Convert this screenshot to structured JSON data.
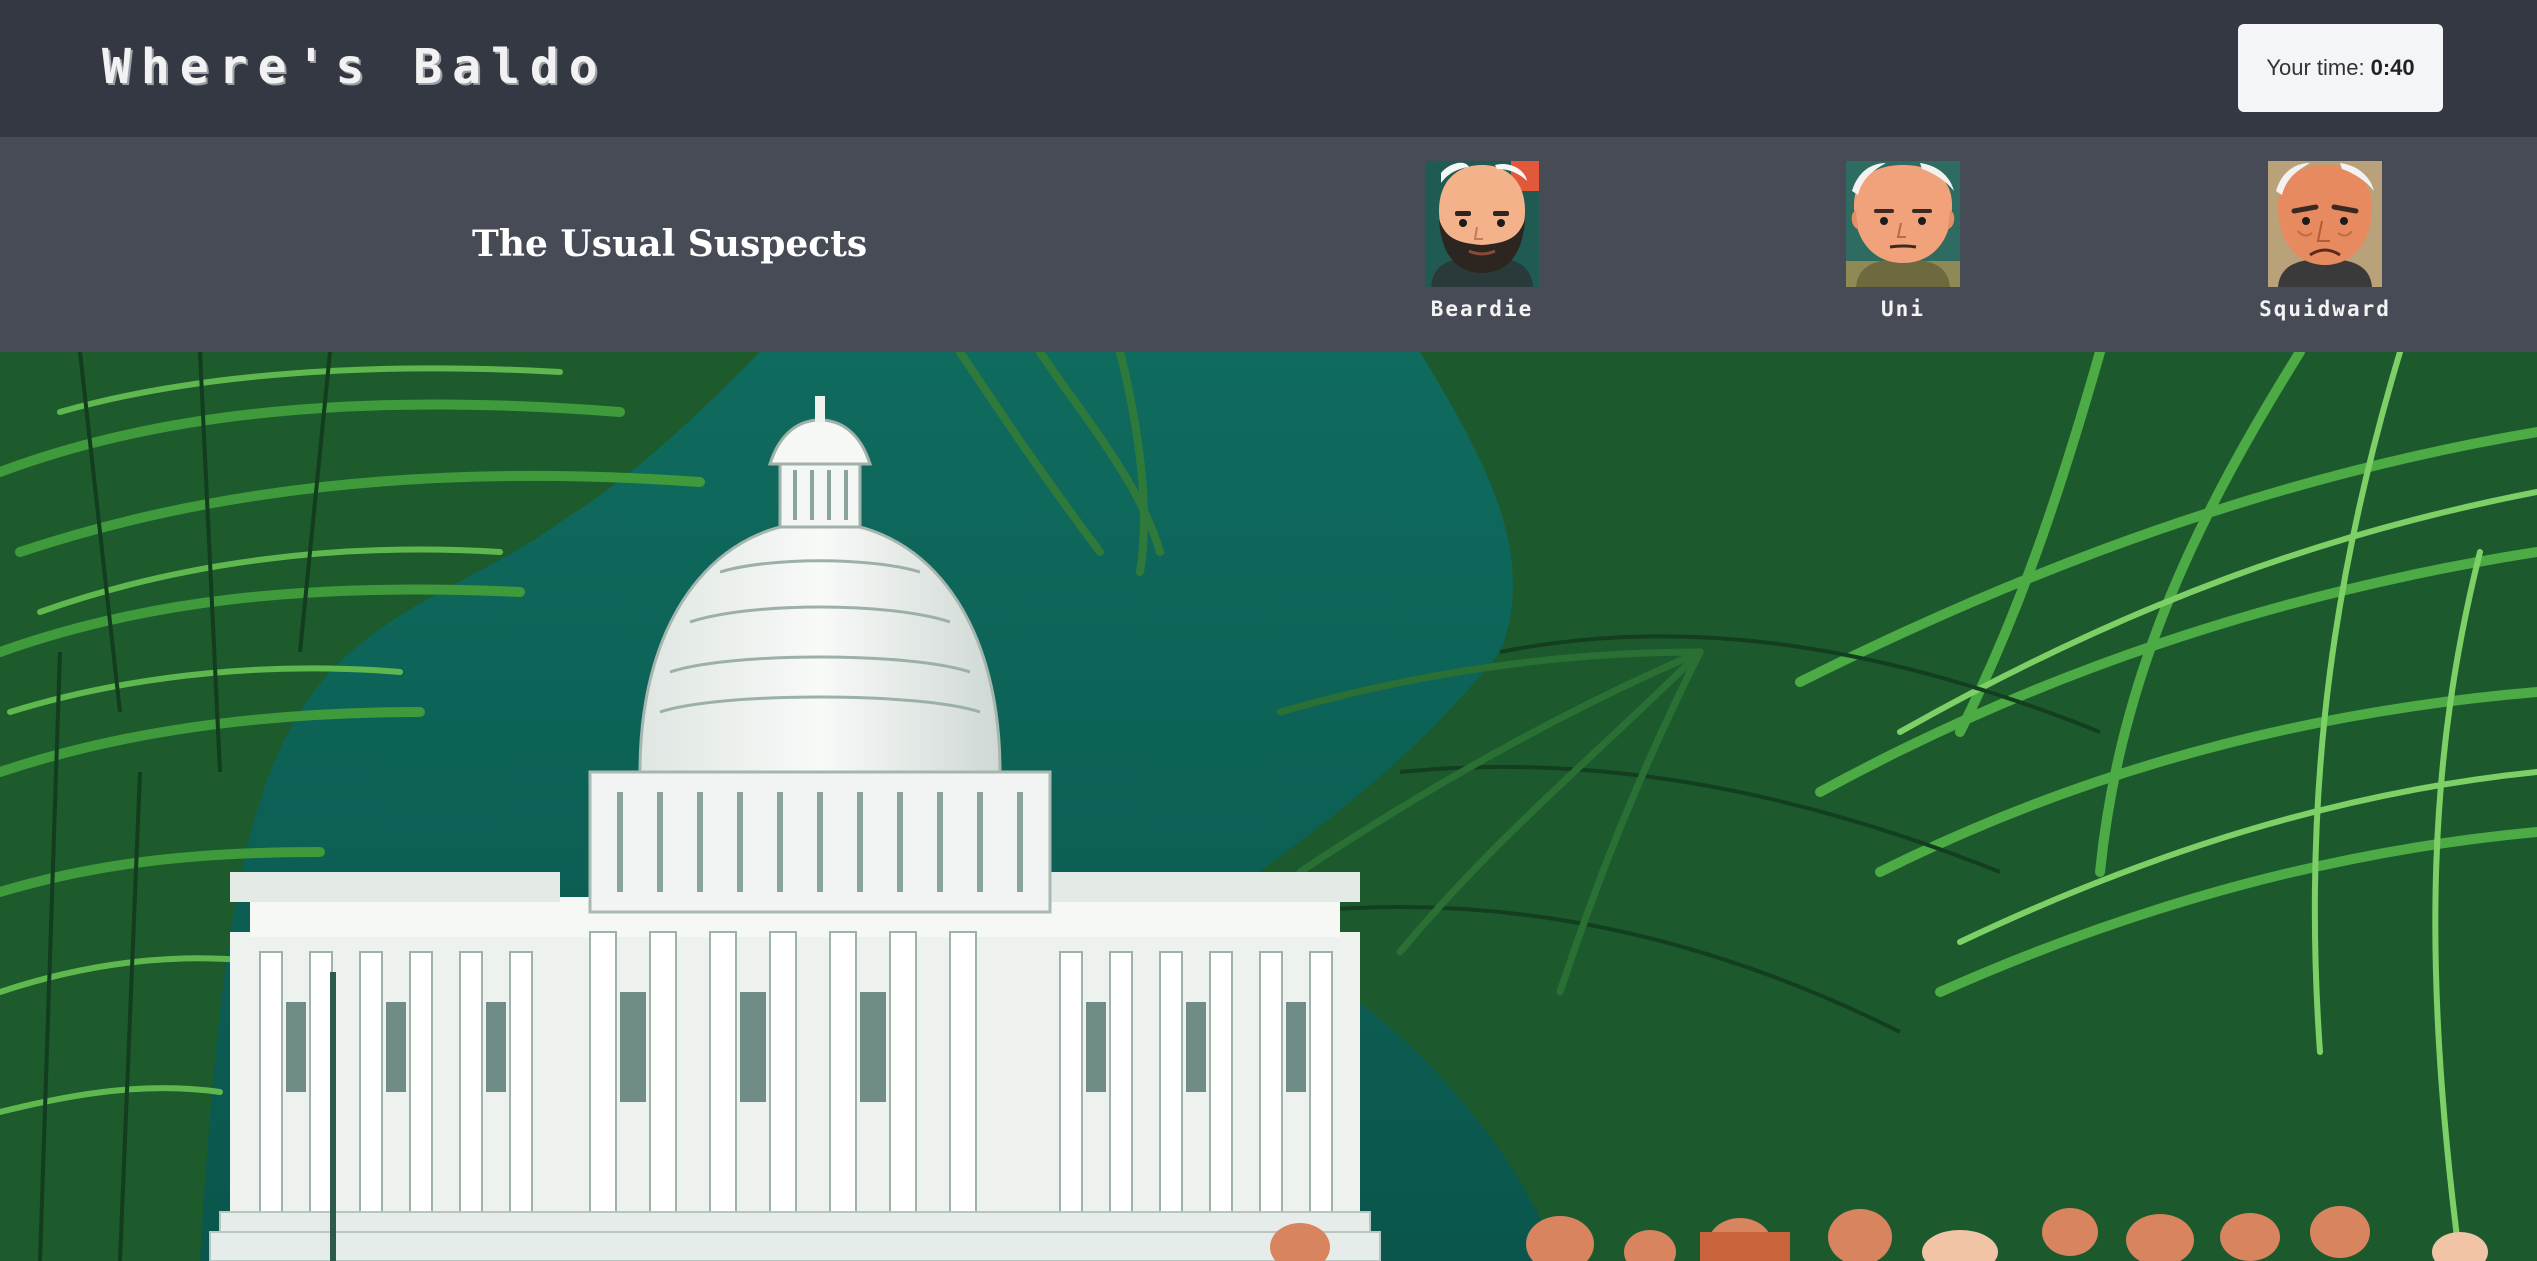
{
  "header": {
    "title": "Where's Baldo",
    "timer_label": "Your time:",
    "timer_value": "0:40"
  },
  "suspects": {
    "title": "The Usual Suspects",
    "items": [
      {
        "name": "Beardie",
        "icon": "bearded-bald-man-avatar"
      },
      {
        "name": "Uni",
        "icon": "bald-man-avatar"
      },
      {
        "name": "Squidward",
        "icon": "frowning-bald-man-avatar"
      }
    ]
  },
  "scene": {
    "description_icon": "capitol-jungle-scene"
  },
  "colors": {
    "header_bg": "#343842",
    "suspects_bg": "#474b55",
    "timer_bg": "#f4f5f8",
    "scene_sky": "#0d5d52"
  }
}
